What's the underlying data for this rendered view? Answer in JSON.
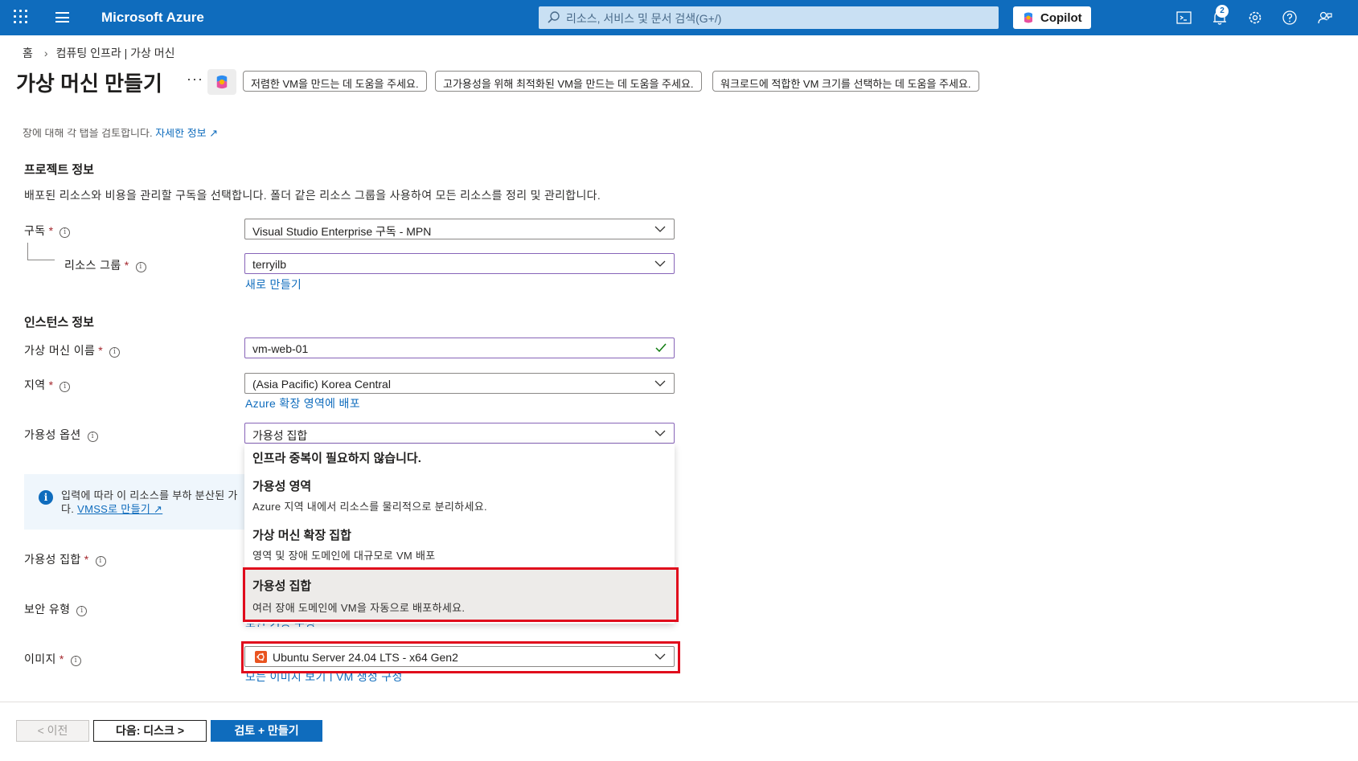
{
  "topbar": {
    "brand": "Microsoft Azure",
    "search_placeholder": "리소스, 서비스 및 문서 검색(G+/)",
    "copilot_label": "Copilot",
    "notification_count": "2"
  },
  "breadcrumb": {
    "home": "홈",
    "current": "컴퓨팅 인프라 | 가상 머신"
  },
  "page": {
    "title": "가상 머신 만들기",
    "more": "···",
    "suggestions": [
      "저렴한 VM을 만드는 데 도움을 주세요.",
      "고가용성을 위해 최적화된 VM을 만드는 데 도움을 주세요.",
      "워크로드에 적합한 VM 크기를 선택하는 데 도움을 주세요."
    ]
  },
  "top_partial": {
    "text": "장에 대해 각 탭을 검토합니다. ",
    "link": "자세한 정보 ↗"
  },
  "project": {
    "heading": "프로젝트 정보",
    "description": "배포된 리소스와 비용을 관리할 구독을 선택합니다. 폴더 같은 리소스 그룹을 사용하여 모든 리소스를 정리 및 관리합니다.",
    "subscription_label": "구독",
    "subscription_value": "Visual Studio Enterprise 구독 - MPN",
    "resource_group_label": "리소스 그룹",
    "resource_group_value": "terryilb",
    "create_new": "새로 만들기"
  },
  "instance": {
    "heading": "인스턴스 정보",
    "vm_name_label": "가상 머신 이름",
    "vm_name_value": "vm-web-01",
    "region_label": "지역",
    "region_value": "(Asia Pacific) Korea Central",
    "extended_zone_link": "Azure 확장 영역에 배포",
    "availability_label": "가용성 옵션",
    "availability_value": "가용성 집합",
    "banner_line1": "입력에 따라 이 리소스를 부하 분산된 가",
    "banner_line2_prefix": "다. ",
    "banner_link": "VMSS로 만들기 ↗",
    "availability_set_label": "가용성 집합",
    "security_type_label": "보안 유형",
    "security_config_link": "보안 기능 구성",
    "image_label": "이미지",
    "image_value": "Ubuntu Server 24.04 LTS - x64 Gen2",
    "image_links": "모든 이미지 보기 | VM 생성 구성"
  },
  "availability_options": [
    {
      "title": "인프라 중복이 필요하지 않습니다.",
      "desc": ""
    },
    {
      "title": "가용성 영역",
      "desc": "Azure 지역 내에서 리소스를 물리적으로 분리하세요."
    },
    {
      "title": "가상 머신 확장 집합",
      "desc": "영역 및 장애 도메인에 대규모로 VM 배포"
    },
    {
      "title": "가용성 집합",
      "desc": "여러 장애 도메인에 VM을 자동으로 배포하세요.",
      "selected": true
    }
  ],
  "footer": {
    "prev": "< 이전",
    "next": "다음: 디스크 >",
    "review": "검토 + 만들기"
  },
  "colors": {
    "accent": "#0f6cbd",
    "highlight_box": "#e00b1c",
    "field_focus": "#8764b8",
    "required": "#a4262c"
  }
}
